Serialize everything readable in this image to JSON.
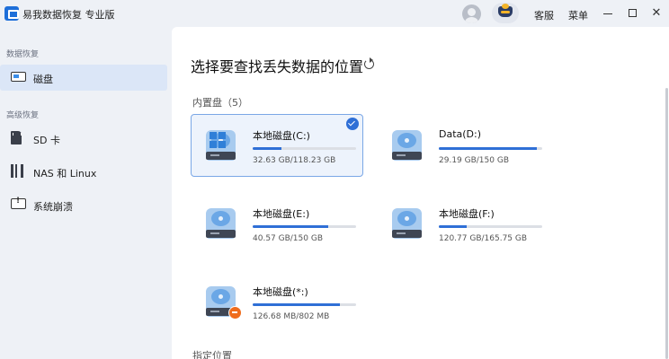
{
  "titlebar": {
    "app_title": "易我数据恢复 专业版",
    "service_label": "客服",
    "menu_label": "菜单",
    "minimize_glyph": "",
    "maximize_glyph": "",
    "close_glyph": "✕"
  },
  "sidebar": {
    "section_recovery": "数据恢复",
    "section_advanced": "高级恢复",
    "items": [
      {
        "label": "磁盘",
        "icon": "disk-icon",
        "active": true
      },
      {
        "label": "SD 卡",
        "icon": "sd-card-icon",
        "active": false
      },
      {
        "label": "NAS 和 Linux",
        "icon": "nas-icon",
        "active": false
      },
      {
        "label": "系统崩溃",
        "icon": "system-crash-icon",
        "active": false
      }
    ]
  },
  "main": {
    "title": "选择要查找丢失数据的位置",
    "internal_disks_label": "内置盘（5）",
    "specified_location_label": "指定位置",
    "drives": [
      {
        "name": "本地磁盘(C:)",
        "size": "32.63 GB/118.23 GB",
        "used_fraction": 0.276,
        "system": true,
        "selected": true
      },
      {
        "name": "Data(D:)",
        "size": "29.19 GB/150 GB",
        "used_fraction": 0.946,
        "system": false,
        "selected": false
      },
      {
        "name": "本地磁盘(E:)",
        "size": "40.57 GB/150 GB",
        "used_fraction": 0.73,
        "system": false,
        "selected": false
      },
      {
        "name": "本地磁盘(F:)",
        "size": "120.77 GB/165.75 GB",
        "used_fraction": 0.271,
        "system": false,
        "selected": false
      },
      {
        "name": "本地磁盘(*:)",
        "size": "126.68 MB/802 MB",
        "used_fraction": 0.842,
        "system": false,
        "selected": false
      }
    ]
  },
  "colors": {
    "accent": "#2f6fd6",
    "sidebar_active": "#dbe6f7",
    "badge_orange": "#ef6c1d"
  }
}
